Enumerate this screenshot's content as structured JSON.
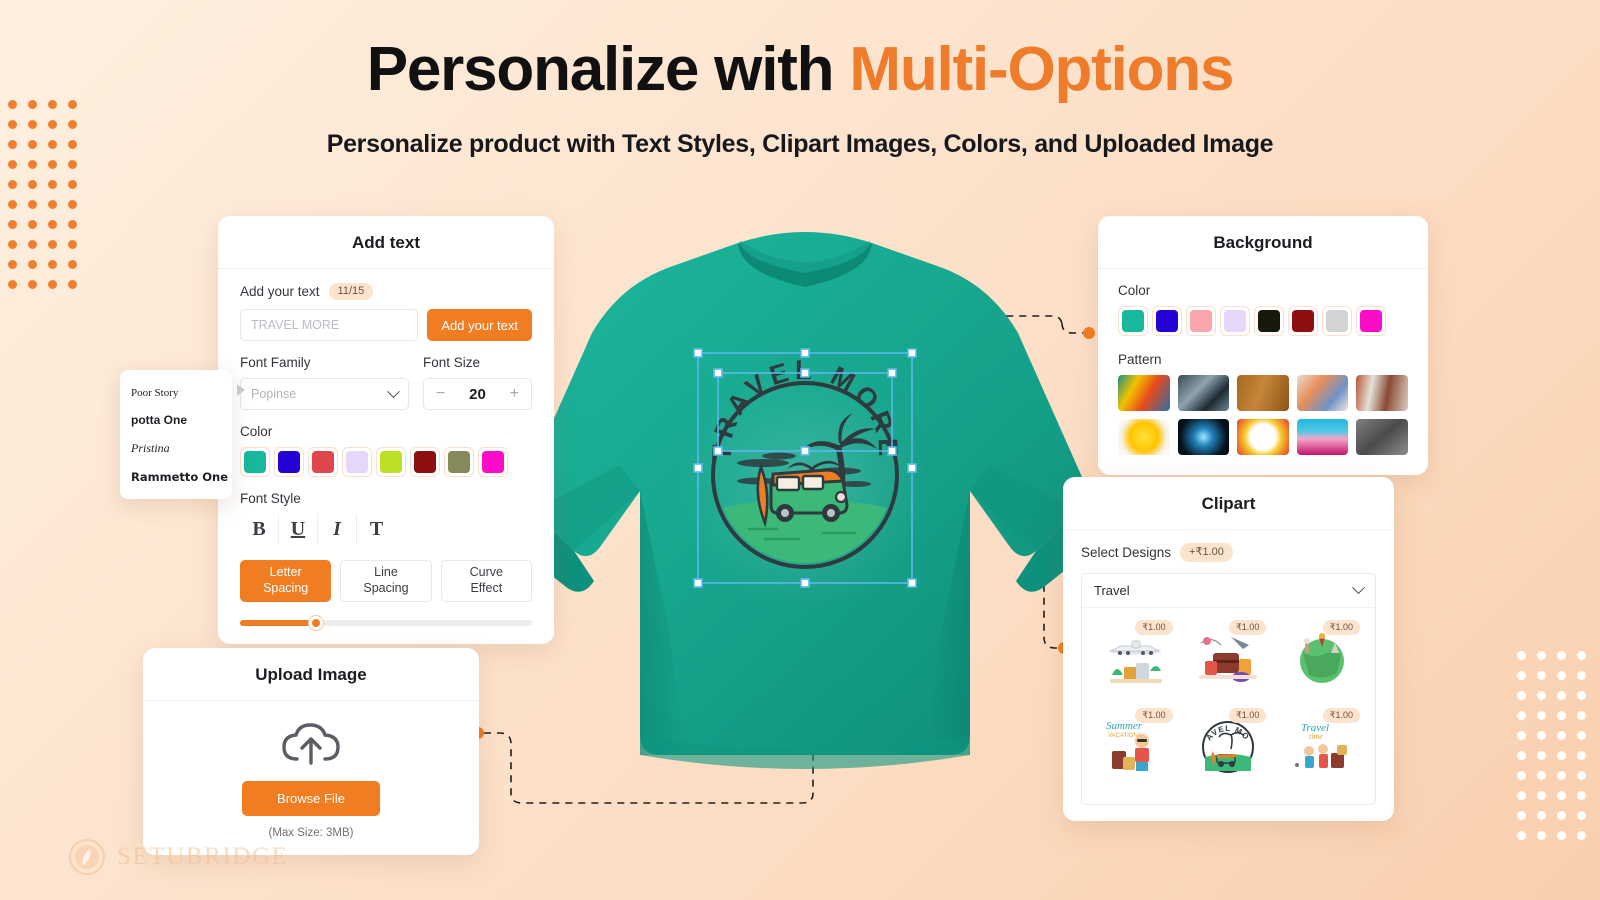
{
  "header": {
    "title_plain": "Personalize with ",
    "title_accent": "Multi-Options",
    "subtitle": "Personalize product with Text Styles, Clipart Images, Colors, and Uploaded Image"
  },
  "brand": {
    "name": "SETUBRIDGE",
    "accent": "#f07d22"
  },
  "add_text": {
    "title": "Add text",
    "field_label": "Add your text",
    "counter": "11/15",
    "input_placeholder": "TRAVEL MORE",
    "add_button": "Add your text",
    "font_family_label": "Font Family",
    "font_family_value": "Popinse",
    "font_size_label": "Font Size",
    "font_size_value": "20",
    "minus": "−",
    "plus": "+",
    "color_label": "Color",
    "colors": [
      "#17b89b",
      "#2403d6",
      "#e0474c",
      "#e6d6fa",
      "#bbe024",
      "#8d0f0f",
      "#87895a",
      "#fa0cc8"
    ],
    "font_style_label": "Font Style",
    "font_styles": [
      "B",
      "U",
      "I",
      "T"
    ],
    "segments": [
      {
        "line1": "Letter",
        "line2": "Spacing",
        "active": true
      },
      {
        "line1": "Line",
        "line2": "Spacing",
        "active": false
      },
      {
        "line1": "Curve",
        "line2": "Effect",
        "active": false
      }
    ],
    "slider_percent": 26
  },
  "font_popup": {
    "options": [
      "Poor Story",
      "potta One",
      "Pristina",
      "Rammetto One"
    ]
  },
  "upload": {
    "title": "Upload Image",
    "icon": "cloud-upload-icon",
    "button": "Browse File",
    "note": "(Max Size: 3MB)"
  },
  "background": {
    "title": "Background",
    "color_label": "Color",
    "colors": [
      "#17b89b",
      "#2403d6",
      "#fba5ae",
      "#e6d6fa",
      "#18180d",
      "#8d0f0f",
      "#d3d3d3",
      "#fa0cc8"
    ],
    "pattern_label": "Pattern",
    "patterns": [
      "abstract-paint",
      "ice-crack",
      "wood-grain",
      "floral-watercolor",
      "brick-mosaic",
      "yellow-burst",
      "blue-arc-reactor",
      "comic-explosion",
      "halftone-pink",
      "grey-concrete"
    ]
  },
  "clipart": {
    "title": "Clipart",
    "select_label": "Select Designs",
    "price_badge": "+₹1.00",
    "category": "Travel",
    "items": [
      {
        "name": "airplane-luggage-clipart",
        "price": "₹1.00"
      },
      {
        "name": "suitcase-travel-clipart",
        "price": "₹1.00"
      },
      {
        "name": "globe-landmarks-clipart",
        "price": "₹1.00"
      },
      {
        "name": "summer-vacations-clipart",
        "price": "₹1.00"
      },
      {
        "name": "travel-more-badge-clipart",
        "price": "₹1.00"
      },
      {
        "name": "travel-time-clipart",
        "price": "₹1.00"
      }
    ]
  },
  "product": {
    "name": "long-sleeve-sweatshirt",
    "color": "#17ab93",
    "design_text": "TRAVEL MORE",
    "design_name": "travel-more-vintage-badge"
  }
}
